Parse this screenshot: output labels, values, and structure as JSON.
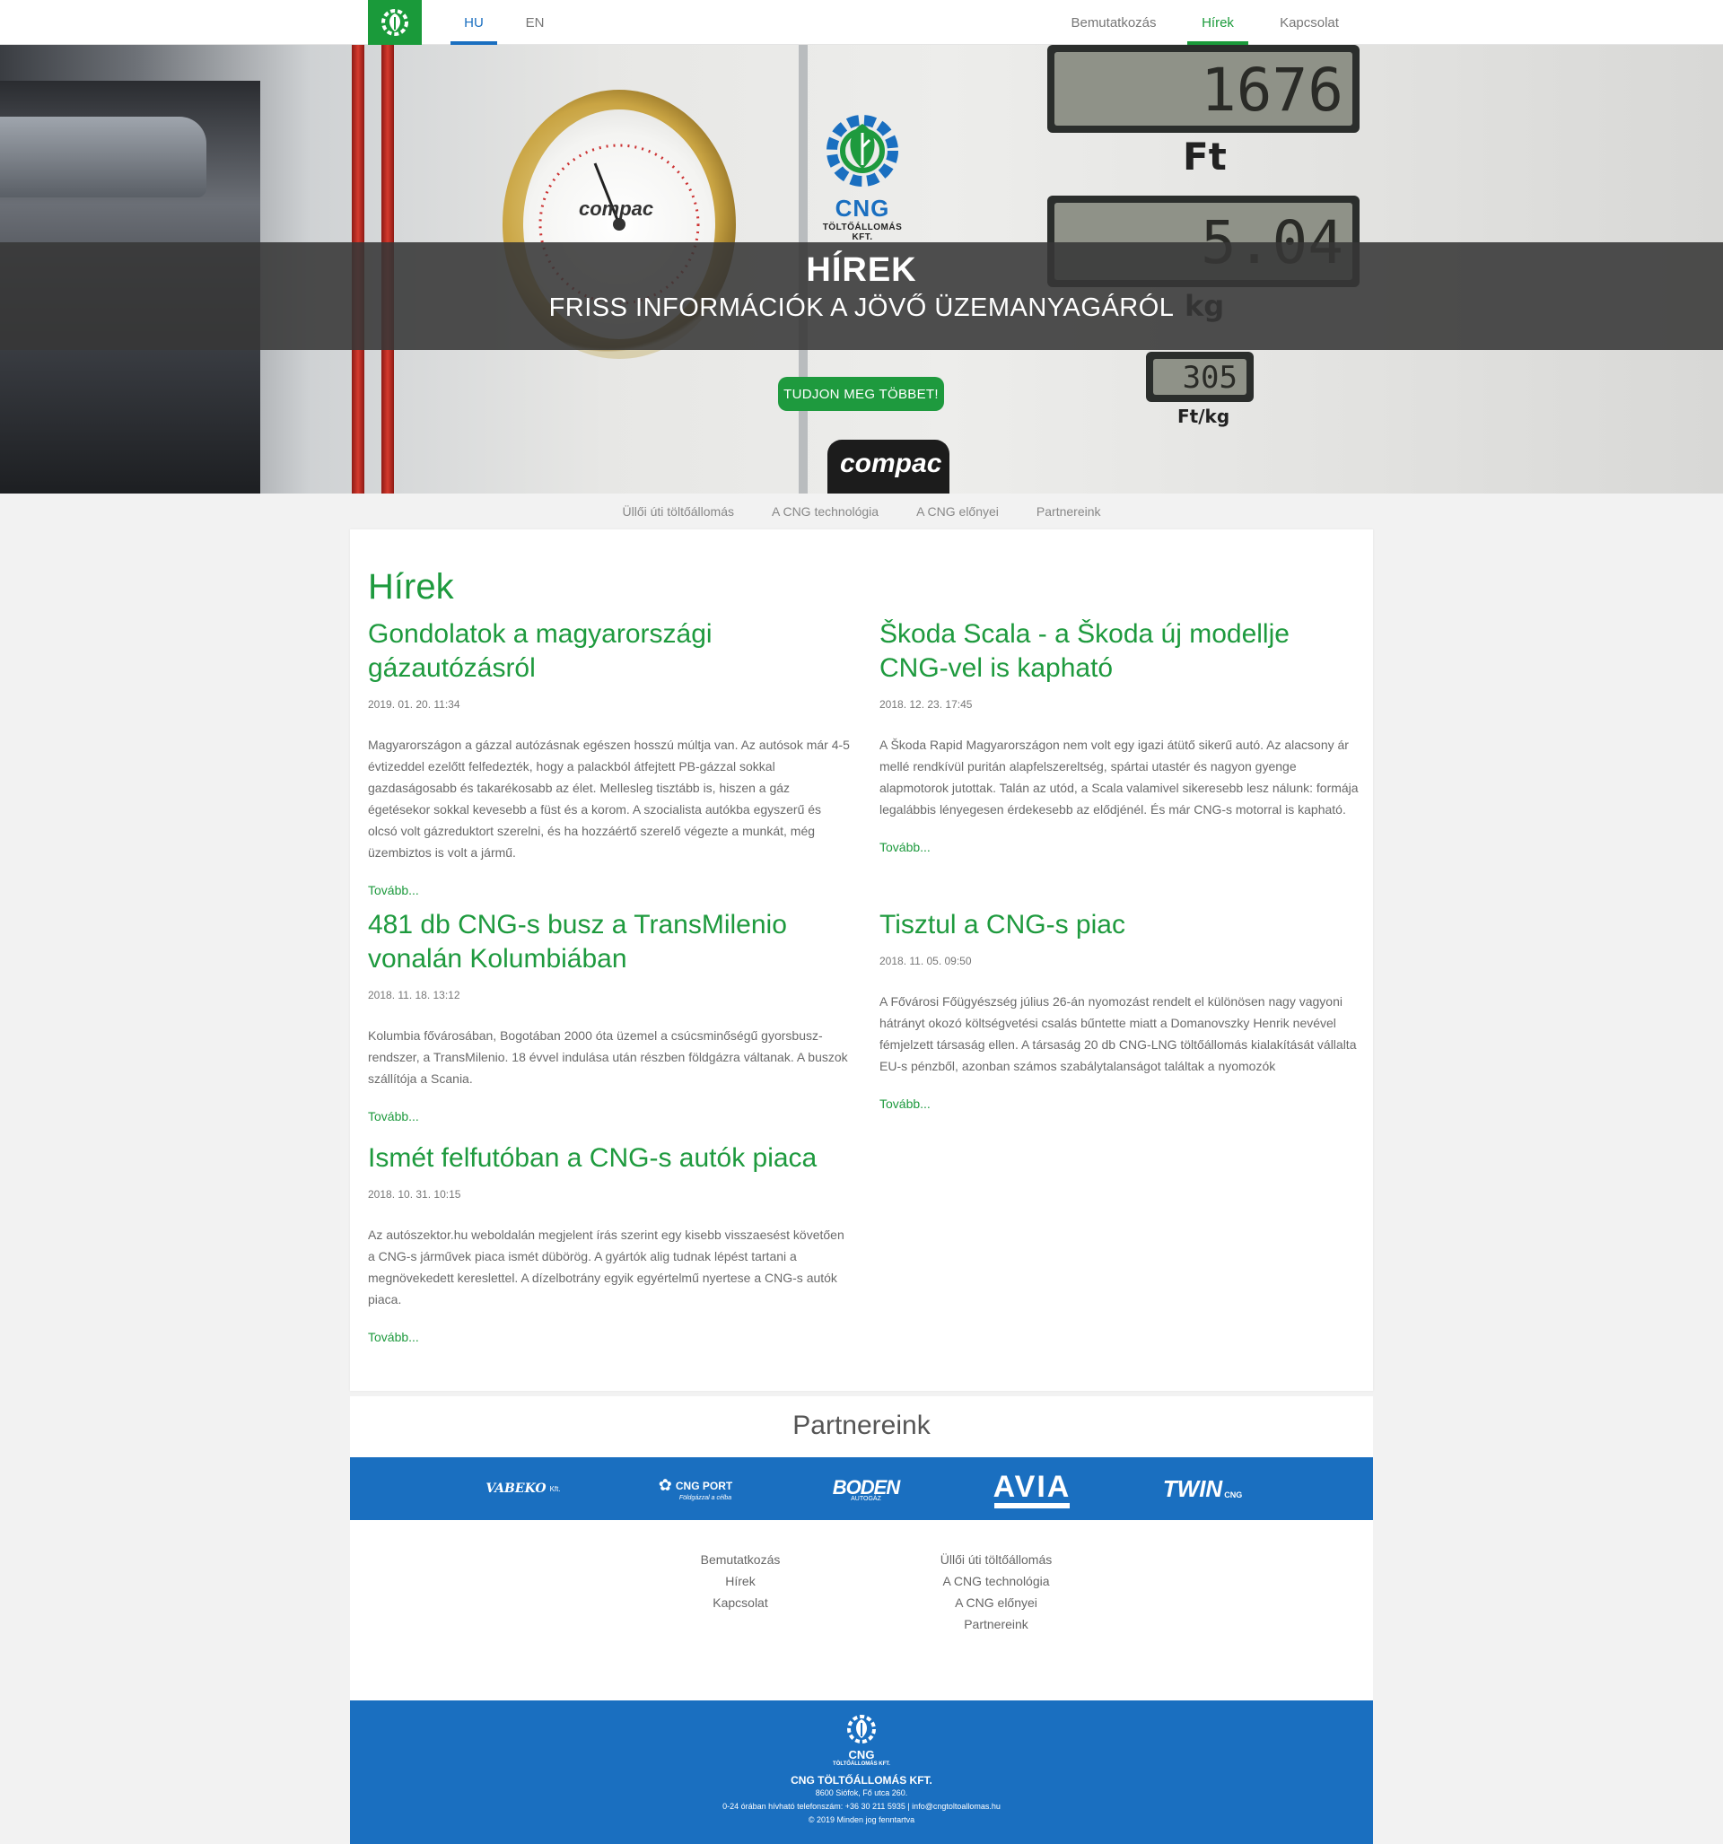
{
  "topnav": {
    "logo_icon": "leaf-gear-icon",
    "langs": [
      {
        "label": "HU",
        "active": true
      },
      {
        "label": "EN",
        "active": false
      }
    ],
    "menu": [
      {
        "label": "Bemutatkozás",
        "active": false
      },
      {
        "label": "Hírek",
        "active": true
      },
      {
        "label": "Kapcsolat",
        "active": false
      }
    ]
  },
  "hero": {
    "title": "HÍREK",
    "subtitle": "FRISS INFORMÁCIÓK A JÖVŐ ÜZEMANYAGÁRÓL",
    "button": "TUDJON MEG TÖBBET!",
    "photo": {
      "logo_text": "CNG",
      "logo_sub": "TÖLTŐÁLLOMÁS KFT.",
      "gauge_brand": "compac",
      "display_price": "1676",
      "display_price_unit": "Ft",
      "display_kg": "5.04",
      "display_kg_unit": "kg",
      "display_unit_price": "305",
      "display_unit_price_unit": "Ft/kg",
      "pump_brand": "compac"
    }
  },
  "subnav": [
    "Üllői úti töltőállomás",
    "A CNG technológia",
    "A CNG előnyei",
    "Partnereink"
  ],
  "news": {
    "title": "Hírek",
    "more_label": "Tovább...",
    "articles": [
      {
        "title": "Gondolatok a magyarországi gázautózásról",
        "date": "2019. 01. 20. 11:34",
        "text": "Magyarországon a gázzal autózásnak egészen hosszú múltja van. Az autósok már 4-5 évtizeddel ezelőtt felfedezték, hogy a palackból átfejtett PB-gázzal sokkal gazdaságosabb és takarékosabb az élet. Mellesleg tisztább is, hiszen a gáz égetésekor sokkal kevesebb a füst és a korom. A szocialista autókba egyszerű és olcsó volt gázreduktort szerelni, és ha hozzáértő szerelő végezte a munkát, még üzembiztos is volt a jármű."
      },
      {
        "title": "Škoda Scala - a Škoda új modellje CNG-vel is kapható",
        "date": "2018. 12. 23. 17:45",
        "text": "A Škoda Rapid Magyarországon nem volt egy igazi átütő sikerű autó. Az alacsony ár mellé rendkívül puritán alapfelszereltség, spártai utastér és nagyon gyenge alapmotorok jutottak. Talán az utód, a Scala valamivel sikeresebb lesz nálunk: formája legalábbis lényegesen érdekesebb az elődjénél. És már CNG-s motorral is kapható."
      },
      {
        "title": "481 db CNG-s busz a TransMilenio vonalán Kolumbiában",
        "date": "2018. 11. 18. 13:12",
        "text": "Kolumbia fővárosában, Bogotában 2000 óta üzemel a csúcsminőségű gyorsbusz-rendszer, a TransMilenio. 18 évvel indulása után részben földgázra váltanak. A buszok szállítója a Scania."
      },
      {
        "title": "Tisztul a CNG-s piac",
        "date": "2018. 11. 05. 09:50",
        "text": "A Fővárosi Főügyészség július 26-án nyomozást rendelt el különösen nagy vagyoni hátrányt okozó költségvetési csalás bűntette miatt a Domanovszky Henrik nevével fémjelzett társaság ellen. A társaság 20 db CNG-LNG töltőállomás kialakítását vállalta EU-s pénzből, azonban számos szabálytalanságot találtak a nyomozók"
      },
      {
        "title": "Ismét felfutóban a CNG-s autók piaca",
        "date": "2018. 10. 31. 10:15",
        "text": "Az autószektor.hu weboldalán megjelent írás szerint egy kisebb visszaesést követően a CNG-s járművek piaca ismét dübörög. A gyártók alig tudnak lépést tartani a megnövekedett kereslettel. A dízelbotrány egyik egyértelmű nyertese a CNG-s autók piaca."
      }
    ]
  },
  "partners": {
    "title": "Partnereink",
    "logos": [
      {
        "name": "VABEKO",
        "sub": "Kft."
      },
      {
        "name": "CNG PORT",
        "sub": "Földgázzal a célba"
      },
      {
        "name": "BODEN",
        "sub": "AUTOGÁZ"
      },
      {
        "name": "AVIA",
        "sub": ""
      },
      {
        "name": "TWIN",
        "sub": "CNG"
      }
    ]
  },
  "footer_links": {
    "col1": [
      "Bemutatkozás",
      "Hírek",
      "Kapcsolat"
    ],
    "col2": [
      "Üllői úti töltőállomás",
      "A CNG technológia",
      "A CNG előnyei",
      "Partnereink"
    ]
  },
  "footer": {
    "logo_text": "CNG",
    "logo_sub": "TÖLTŐÁLLOMÁS KFT.",
    "company": "CNG TÖLTŐÁLLOMÁS KFT.",
    "address": "8600 Siófok, Fő utca 260.",
    "contact": "0-24 órában hívható telefonszám: +36 30 211 5935 | info@cngtoltoallomas.hu",
    "copyright": "© 2019 Minden jog fenntartva"
  },
  "colors": {
    "green": "#1e9a3e",
    "blue": "#1a6fc0"
  }
}
